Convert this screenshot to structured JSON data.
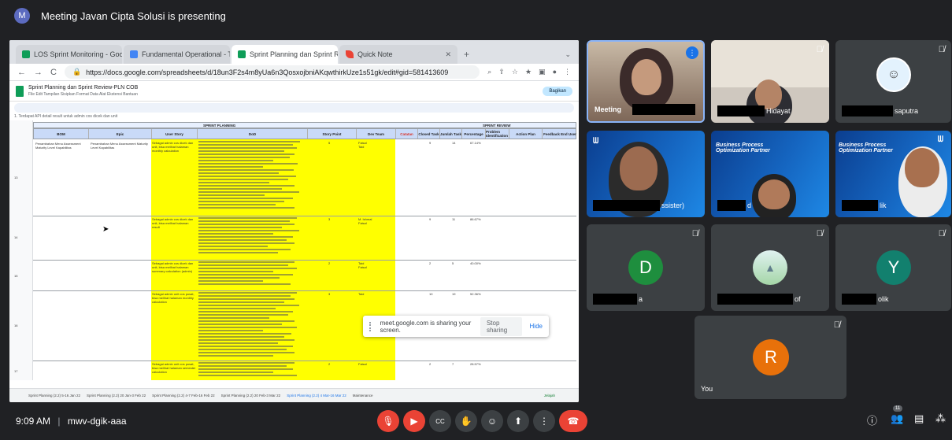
{
  "presenter": {
    "avatar_letter": "M",
    "text": "Meeting Javan Cipta Solusi is presenting"
  },
  "browser": {
    "tabs": [
      {
        "label": "LOS Sprint Monitoring - Goog",
        "color": "#0f9d58",
        "active": false
      },
      {
        "label": "Fundamental Operational - Tri",
        "color": "#4285f4",
        "active": false
      },
      {
        "label": "Sprint Planning dan Sprint Rev",
        "color": "#0f9d58",
        "active": true
      },
      {
        "label": "Quick Note",
        "color": "#ea4335",
        "active": false
      }
    ],
    "url": "https://docs.google.com/spreadsheets/d/18un3F2s4m8yUa6n3QosxojbniAKqwthirkUze1s51gk/edit#gid=581413609"
  },
  "sheet": {
    "title": "Sprint Planning dan Sprint Review-PLN COB",
    "menu": "File  Edit  Tampilan  Sisipkan  Format  Data  Alat  Ekstensi  Bantuan",
    "share": "Bagikan",
    "formula": "1. Terdapat API detail result untuk admin cos dicek dan unit",
    "section_planning": "SPRINT PLANNING",
    "section_review": "SPRINT REVIEW",
    "columns": [
      "BOM",
      "Epic",
      "User Story",
      "DoD",
      "Story Point",
      "Dev Team",
      "Catatan",
      "Closed Task",
      "Jumlah Task",
      "Percentage",
      "Problem Identification",
      "Action Plan",
      "Feedback End User"
    ],
    "bom": "Penambahan Menu Assessment Maturity Level Kapabilitas",
    "epic": "Penambahan Menu Assessment Maturity Level Kapabilitas",
    "rows": [
      {
        "row": "13",
        "story": "Sebagai admin cos dicek dan unit, bisa melihat halaman monthly calculation",
        "point": "5",
        "team": "Faisal\nTaid",
        "closed": "9",
        "total": "14",
        "pct": "67.14%"
      },
      {
        "row": "14",
        "story": "Sebagai admin cos dicek dan unit, bisa melihat halaman result",
        "point": "3",
        "team": "M. Ishmal\nFaisal",
        "closed": "9",
        "total": "11",
        "pct": "86.67%"
      },
      {
        "row": "15",
        "story": "Sebagai admin cos dicek dan unit, bisa melihat halaman summary calculation (admin)",
        "point": "2",
        "team": "Taid\nFaisal",
        "closed": "2",
        "total": "5",
        "pct": "40.00%"
      },
      {
        "row": "16",
        "story": "Sebagai admin unit cos pusat, bisa melihat halaman monthly calculation",
        "point": "3",
        "team": "Taid",
        "closed": "10",
        "total": "19",
        "pct": "52.36%"
      },
      {
        "row": "17",
        "story": "Sebagai admin unit cos pusat, bisa melihat halaman semester calculation",
        "point": "2",
        "team": "Faisal",
        "closed": "2",
        "total": "7",
        "pct": "28.57%"
      }
    ],
    "sheet_tabs": [
      "Sprint Planning (2.2) 5-16 Jan 22",
      "Sprint Planning (2.2) 20 Jan-3 Feb 22",
      "Sprint Planning (2.2) 4-7 Feb-16 Feb 22",
      "Sprint Planning (2.2) 20 Feb-3 Mar 22",
      "Sprint Planning (2.2) 4 Mar-16 Mar 22",
      "Maintenance"
    ],
    "explore": "Jelajah"
  },
  "share_toast": {
    "text": "meet.google.com is sharing your screen.",
    "stop": "Stop sharing",
    "hide": "Hide"
  },
  "participants": [
    {
      "name": "Meeting",
      "type": "video"
    },
    {
      "name": "Hidayat",
      "type": "video"
    },
    {
      "name": "saputra",
      "type": "video"
    },
    {
      "name": "ssister)",
      "type": "video"
    },
    {
      "name": "d",
      "type": "video"
    },
    {
      "name": "lik",
      "type": "video"
    },
    {
      "name": "a",
      "letter": "D",
      "type": "avatar",
      "color": "#1e8e3e"
    },
    {
      "name": "of",
      "type": "photo"
    },
    {
      "name": "olik",
      "letter": "Y",
      "type": "avatar",
      "color": "#12806e"
    },
    {
      "name": "You",
      "letter": "R",
      "type": "avatar",
      "color": "#e8710a"
    }
  ],
  "slide": {
    "line1": "Business Process",
    "line2": "Optimization Partner"
  },
  "meeting": {
    "time": "9:09 AM",
    "code": "mwv-dgik-aaa",
    "people_count": "11"
  },
  "icons": {
    "mic": "microphone-off-icon",
    "cam": "camera-off-icon",
    "cc": "captions-icon",
    "hand": "raise-hand-icon",
    "emoji": "emoji-icon",
    "present": "present-icon",
    "more": "more-icon",
    "end": "end-call-icon",
    "info": "info-icon",
    "people": "people-icon",
    "chat": "chat-icon",
    "activities": "activities-icon"
  }
}
